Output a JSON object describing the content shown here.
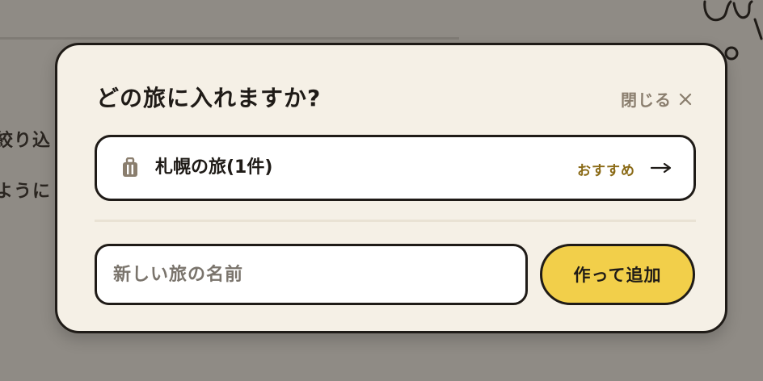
{
  "background": {
    "line1": "絞り込",
    "line2": "ように"
  },
  "modal": {
    "title": "どの旅に入れますか?",
    "close_label": "閉じる",
    "close_icon": "close-icon",
    "trip_option": {
      "icon": "suitcase-icon",
      "name": "札幌の旅(1件)",
      "badge": "おすすめ",
      "arrow_icon": "arrow-right-icon"
    },
    "new_trip": {
      "placeholder": "新しい旅の名前",
      "value": "",
      "button_label": "作って追加"
    }
  },
  "colors": {
    "modal_bg": "#f5f0e6",
    "border": "#1f1b17",
    "accent_button": "#f2cf4a",
    "recommend_text": "#8a6a16",
    "muted_text": "#8a7e6e",
    "overlay_bg": "#8f8b85"
  }
}
